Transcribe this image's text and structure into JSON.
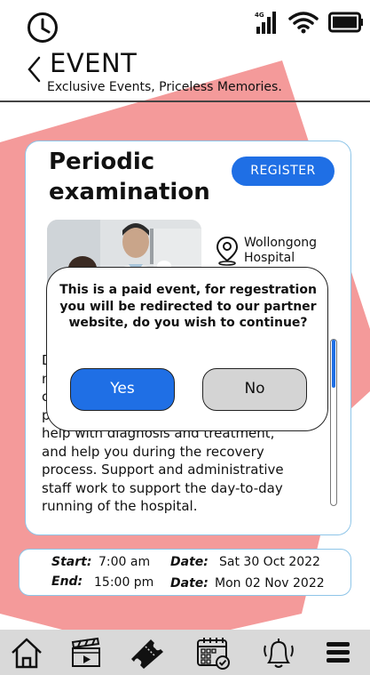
{
  "header": {
    "title": "EVENT",
    "subtitle": "Exclusive Events, Priceless Memories."
  },
  "status_bar": {
    "network": "4G",
    "icons": [
      "clock-icon",
      "signal-icon",
      "wifi-icon",
      "battery-icon"
    ]
  },
  "event": {
    "title_line1": "Periodic",
    "title_line2": "examination",
    "register_label": "REGISTER",
    "location_line1": "Wollongong",
    "location_line2": "Hospital",
    "description_lines": [
      "D",
      "n",
      "c",
      "p",
      "help with diagnosis and treatment,",
      "and help you during the recovery",
      "process. Support and administrative",
      "staff work to support the day-to-day",
      "running of the hospital."
    ]
  },
  "schedule": {
    "start_label": "Start:",
    "start_time": "7:00 am",
    "end_label": "End:",
    "end_time": "15:00 pm",
    "date_label_1": "Date:",
    "start_date": "Sat 30 Oct 2022",
    "date_label_2": "Date:",
    "end_date": "Mon 02 Nov 2022"
  },
  "modal": {
    "message": "This is a paid event, for regestration you will be redirected to our partner website, do you wish to continue?",
    "yes_label": "Yes",
    "no_label": "No"
  },
  "bottom_nav": {
    "items": [
      "home-icon",
      "movies-icon",
      "tickets-icon",
      "calendar-icon",
      "notifications-icon",
      "menu-icon"
    ]
  },
  "colors": {
    "accent": "#1f6fe5",
    "decor": "#f49a9a",
    "card_border": "#8ec5e8",
    "nav_bg": "#d9d9d9"
  }
}
